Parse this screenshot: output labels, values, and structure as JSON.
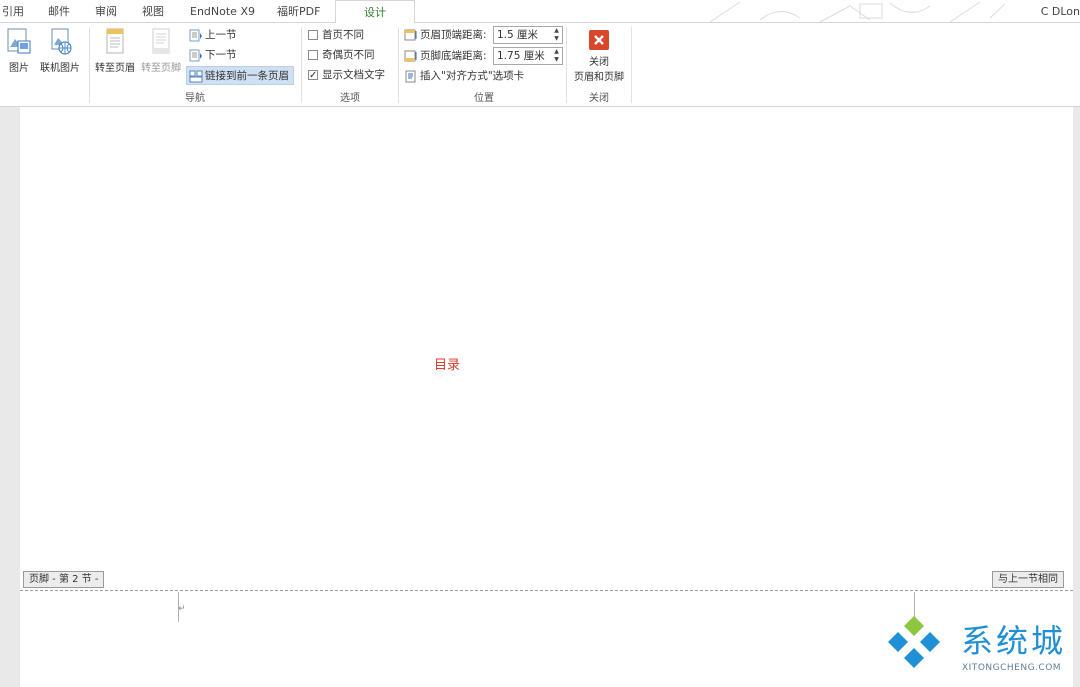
{
  "tabs": [
    "引用",
    "邮件",
    "审阅",
    "视图",
    "EndNote X9",
    "福昕PDF",
    "设计"
  ],
  "active_tab": "设计",
  "user": "C DLon",
  "ribbon": {
    "insert": {
      "picture": "图片",
      "online_picture": "联机图片"
    },
    "navigation": {
      "goto_header": "转至页眉",
      "goto_footer": "转至页脚",
      "prev_section": "上一节",
      "next_section": "下一节",
      "link_previous": "链接到前一条页眉",
      "group_label": "导航"
    },
    "options": {
      "different_first_page": "首页不同",
      "different_odd_even": "奇偶页不同",
      "show_document_text": "显示文档文字",
      "group_label": "选项",
      "checked": [
        false,
        false,
        true
      ]
    },
    "position": {
      "header_from_top_label": "页眉顶端距离:",
      "header_from_top_value": "1.5 厘米",
      "footer_from_bottom_label": "页脚底端距离:",
      "footer_from_bottom_value": "1.75 厘米",
      "insert_alignment_tab": "插入\"对齐方式\"选项卡",
      "group_label": "位置"
    },
    "close": {
      "close_line1": "关闭",
      "close_line2": "页眉和页脚",
      "group_label": "关闭"
    }
  },
  "document": {
    "toc_text": "目录",
    "footer_tag": "页脚 - 第 2 节 -",
    "same_as_previous": "与上一节相同",
    "para_mark": "↵"
  },
  "watermark": {
    "title": "系统城",
    "subtitle": "XITONGCHENG.COM"
  },
  "colors": {
    "active_tab": "#2b7c2b",
    "toc": "#e0392f",
    "close_icon": "#d9472b",
    "watermark_blue": "#1f8fd6",
    "watermark_green": "#8dc63f"
  }
}
